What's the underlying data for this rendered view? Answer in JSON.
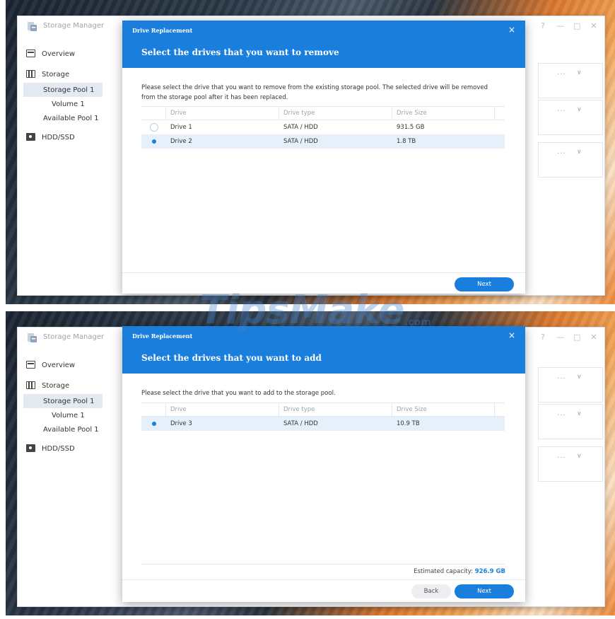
{
  "app": {
    "title": "Storage Manager",
    "controls": {
      "help": "?",
      "minimize": "—",
      "maximize": "□",
      "close": "✕"
    }
  },
  "sidebar": {
    "overview": "Overview",
    "storage": "Storage",
    "storage_pool": "Storage Pool 1",
    "volume": "Volume 1",
    "available_pool": "Available Pool 1",
    "hdd_ssd": "HDD/SSD"
  },
  "bg_cards": {
    "dots": "···",
    "chevron": "∨"
  },
  "dialog_remove": {
    "small_title": "Drive Replacement",
    "close": "×",
    "heading": "Select the drives that you want to remove",
    "description": "Please select the drive that you want to remove from the existing storage pool. The selected drive will be removed from the storage pool after it has been replaced.",
    "columns": {
      "drive": "Drive",
      "type": "Drive type",
      "size": "Drive Size"
    },
    "rows": [
      {
        "drive": "Drive 1",
        "type": "SATA / HDD",
        "size": "931.5 GB",
        "selected": false
      },
      {
        "drive": "Drive 2",
        "type": "SATA / HDD",
        "size": "1.8 TB",
        "selected": true
      }
    ],
    "next_button": "Next"
  },
  "dialog_add": {
    "small_title": "Drive Replacement",
    "close": "×",
    "heading": "Select the drives that you want to add",
    "description": "Please select the drive that you want to add to the storage pool.",
    "columns": {
      "drive": "Drive",
      "type": "Drive type",
      "size": "Drive Size"
    },
    "rows": [
      {
        "drive": "Drive 3",
        "type": "SATA / HDD",
        "size": "10.9 TB",
        "selected": true
      }
    ],
    "capacity_label": "Estimated capacity:",
    "capacity_value": "926.9 GB",
    "back_button": "Back",
    "next_button": "Next"
  },
  "watermark": {
    "text": "TipsMake",
    "suffix": ".com"
  },
  "colors": {
    "accent": "#1a7fdc",
    "selected_row": "#e5f0fb",
    "sidebar_selected": "#e4eaf2"
  }
}
